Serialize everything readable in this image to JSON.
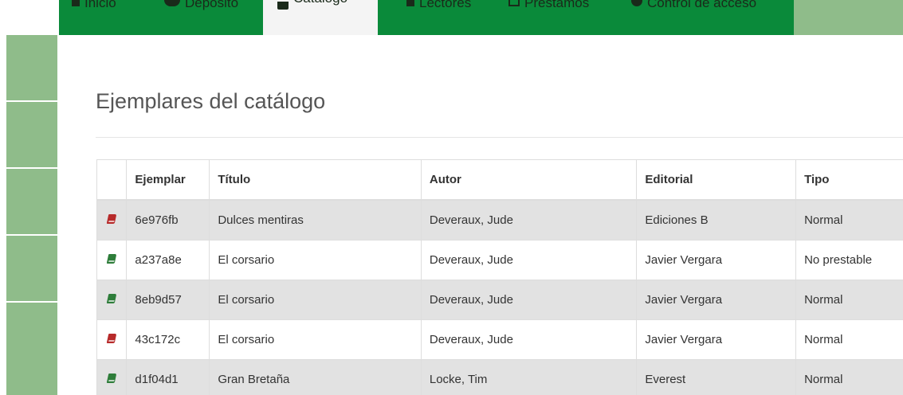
{
  "nav": {
    "tabs": [
      {
        "label": "Inicio",
        "icon": "home-icon"
      },
      {
        "label": "Depósito",
        "icon": "database-icon"
      },
      {
        "label": "Catálogo",
        "icon": "book-icon",
        "active": true
      },
      {
        "label": "Lectores",
        "icon": "user-icon"
      },
      {
        "label": "Préstamos",
        "icon": "calendar-icon"
      },
      {
        "label": "Control de acceso",
        "icon": "lock-icon"
      }
    ]
  },
  "page": {
    "title": "Ejemplares del catálogo"
  },
  "table": {
    "headers": [
      "",
      "Ejemplar",
      "Título",
      "Autor",
      "Editorial",
      "Tipo"
    ],
    "rows": [
      {
        "status": "red",
        "ejemplar": "6e976fb",
        "titulo": "Dulces mentiras",
        "autor": "Deveraux, Jude",
        "editorial": "Ediciones B",
        "tipo": "Normal"
      },
      {
        "status": "green",
        "ejemplar": "a237a8e",
        "titulo": "El corsario",
        "autor": "Deveraux, Jude",
        "editorial": "Javier Vergara",
        "tipo": "No prestable"
      },
      {
        "status": "green",
        "ejemplar": "8eb9d57",
        "titulo": "El corsario",
        "autor": "Deveraux, Jude",
        "editorial": "Javier Vergara",
        "tipo": "Normal"
      },
      {
        "status": "red",
        "ejemplar": "43c172c",
        "titulo": "El corsario",
        "autor": "Deveraux, Jude",
        "editorial": "Javier Vergara",
        "tipo": "Normal"
      },
      {
        "status": "green",
        "ejemplar": "d1f04d1",
        "titulo": "Gran Bretaña",
        "autor": "Locke, Tim",
        "editorial": "Everest",
        "tipo": "Normal"
      }
    ]
  },
  "colors": {
    "nav_green": "#0a8a3a",
    "sidebar_green": "#8fbc8a",
    "status_red": "#b72a2a",
    "status_green": "#2e7d3a",
    "row_shade": "#e2e2e2"
  }
}
